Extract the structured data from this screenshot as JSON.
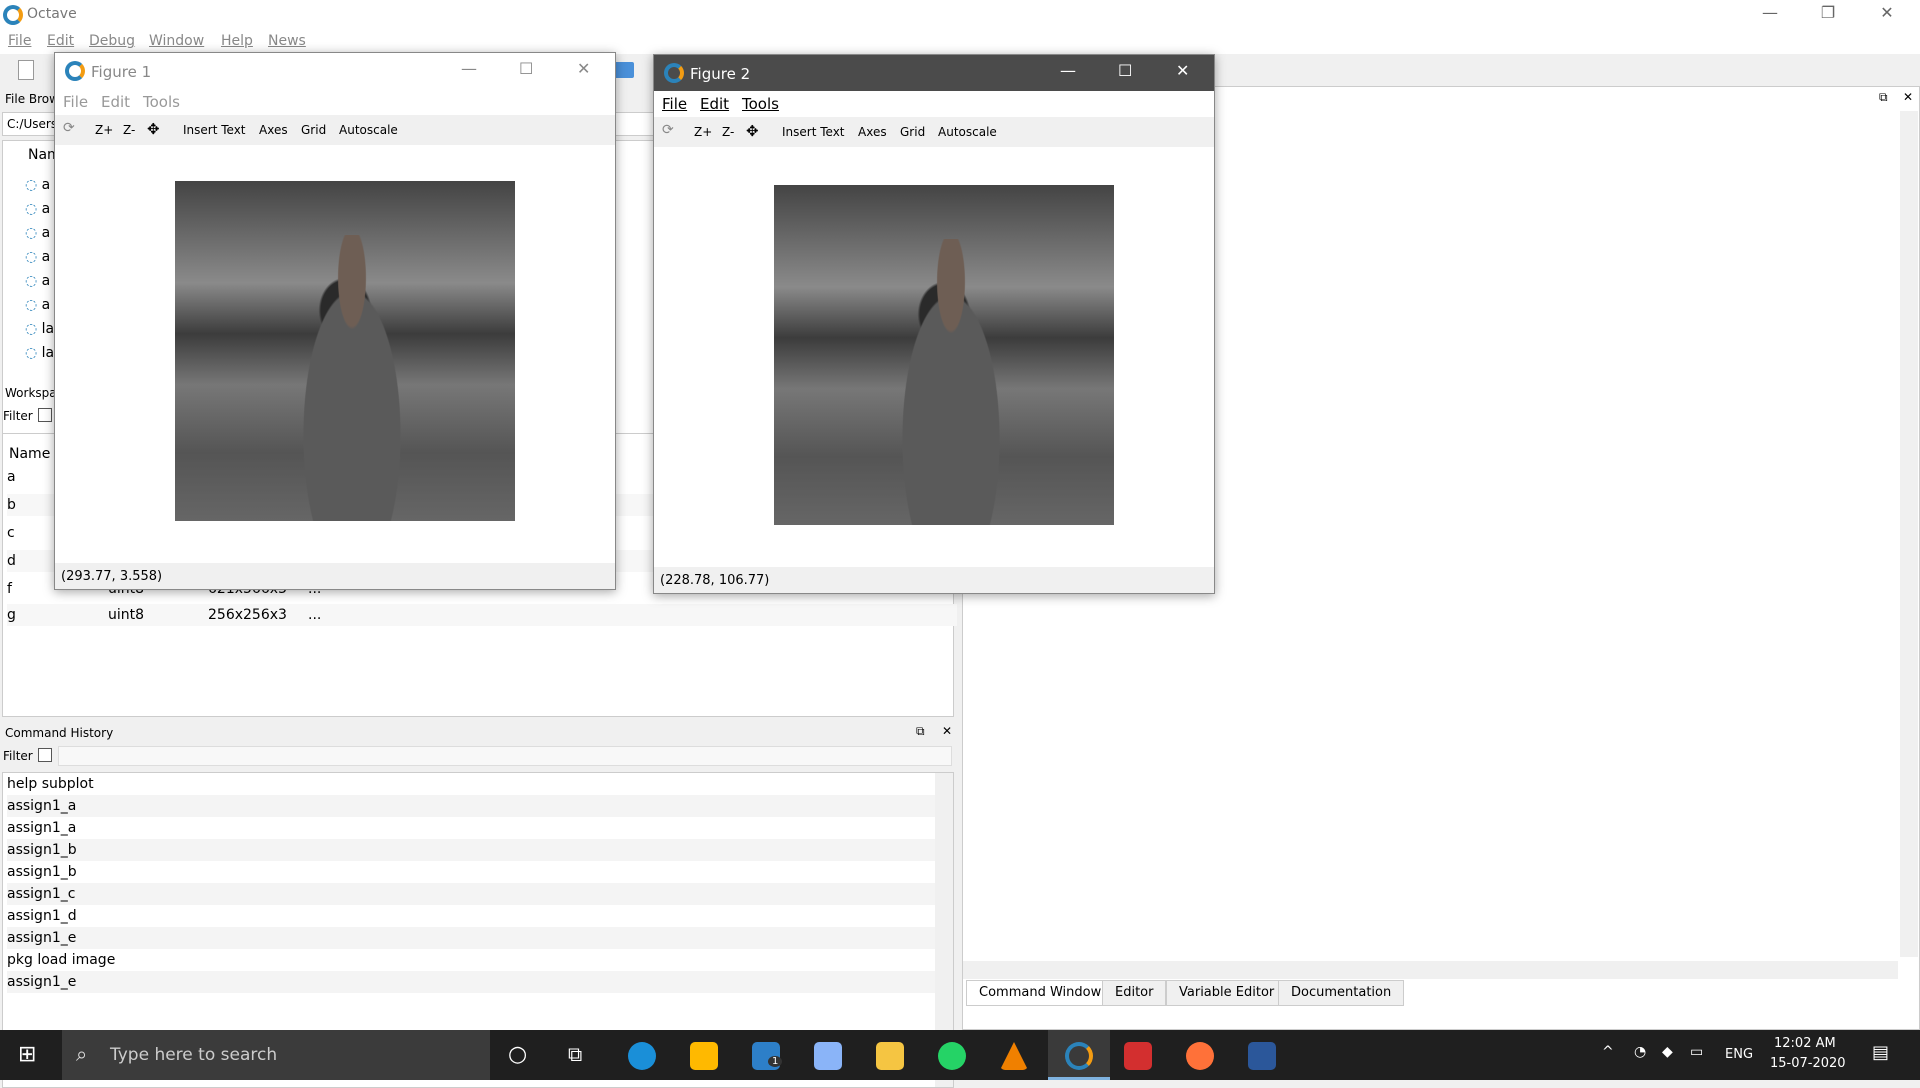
{
  "app": {
    "title": "Octave"
  },
  "menu": [
    "File",
    "Edit",
    "Debug",
    "Window",
    "Help",
    "News"
  ],
  "file_browser": {
    "title": "File Brow",
    "path": "C:/Users",
    "col_name": "Nam",
    "items": [
      "a",
      "a",
      "a",
      "a",
      "a",
      "a",
      "la",
      "la"
    ]
  },
  "workspace": {
    "title": "Workspa",
    "filter_label": "Filter",
    "col_name": "Name",
    "rows": [
      {
        "name": "a",
        "cls": "",
        "dim": "",
        "val": ""
      },
      {
        "name": "b",
        "cls": "",
        "dim": "",
        "val": ""
      },
      {
        "name": "c",
        "cls": "",
        "dim": "",
        "val": ""
      },
      {
        "name": "d",
        "cls": "",
        "dim": "",
        "val": ""
      },
      {
        "name": "f",
        "cls": "uint8",
        "dim": "621x566x3",
        "val": "..."
      },
      {
        "name": "g",
        "cls": "uint8",
        "dim": "256x256x3",
        "val": "..."
      }
    ]
  },
  "history": {
    "title": "Command History",
    "filter_label": "Filter",
    "items": [
      "help subplot",
      "assign1_a",
      "assign1_a",
      "assign1_b",
      "assign1_b",
      "assign1_c",
      "assign1_d",
      "assign1_e",
      "pkg load image",
      "assign1_e"
    ]
  },
  "tabs": [
    "Command Window",
    "Editor",
    "Variable Editor",
    "Documentation"
  ],
  "figure1": {
    "title": "Figure 1",
    "menu": [
      "File",
      "Edit",
      "Tools"
    ],
    "tools": [
      "Z+",
      "Z-",
      "Insert Text",
      "Axes",
      "Grid",
      "Autoscale"
    ],
    "status": "(293.77, 3.558)"
  },
  "figure2": {
    "title": "Figure 2",
    "menu": [
      "File",
      "Edit",
      "Tools"
    ],
    "tools": [
      "Z+",
      "Z-",
      "Insert Text",
      "Axes",
      "Grid",
      "Autoscale"
    ],
    "status": "(228.78, 106.77)"
  },
  "taskbar": {
    "search_placeholder": "Type here to search",
    "lang": "ENG",
    "time": "12:02 AM",
    "date": "15-07-2020",
    "mail_badge": "1"
  }
}
